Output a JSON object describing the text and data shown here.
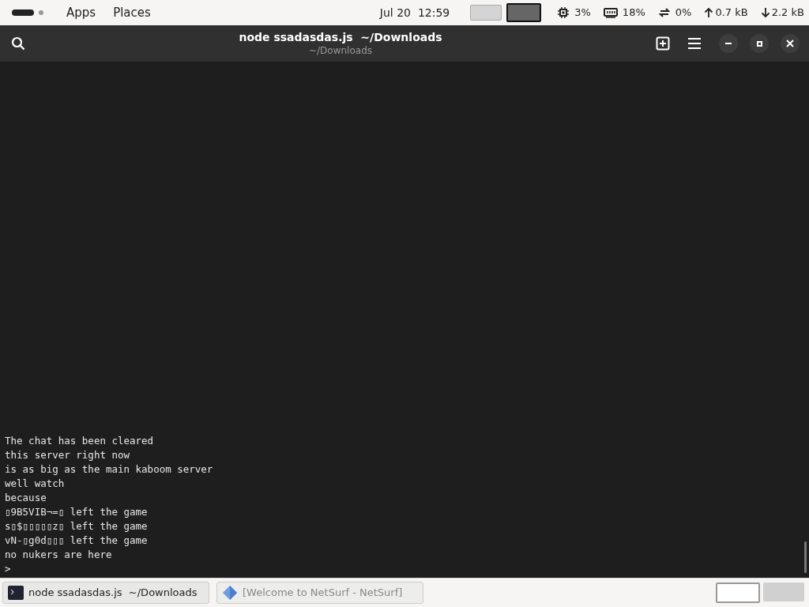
{
  "top_bar": {
    "menus": [
      "Apps",
      "Places"
    ],
    "clock": "Jul 20  12:59",
    "workspaces": [
      {
        "selected": false
      },
      {
        "selected": true
      }
    ],
    "indicators": [
      {
        "kind": "cpu",
        "text": "3%"
      },
      {
        "kind": "memory",
        "text": "18%"
      },
      {
        "kind": "swap",
        "text": "0%"
      },
      {
        "kind": "upload",
        "text": "0.7 kB"
      },
      {
        "kind": "download",
        "text": "2.2 kB"
      }
    ]
  },
  "window": {
    "title": "node ssadasdas.js  ~/Downloads",
    "subtitle": "~/Downloads"
  },
  "terminal": {
    "lines": [
      "The chat has been cleared",
      "this server right now",
      "is as big as the main kaboom server",
      "well watch",
      "because",
      "▯9B5VIB¬=▯ left the game",
      "s▯$▯▯▯▯▯z▯ left the game",
      "vN-▯g0d▯▯▯ left the game",
      "no nukers are here",
      ">"
    ]
  },
  "taskbar": {
    "tasks": [
      {
        "kind": "terminal",
        "label": "node ssadasdas.js  ~/Downloads",
        "selected": true
      },
      {
        "kind": "browser",
        "label": "[Welcome to NetSurf - NetSurf]",
        "selected": false
      }
    ],
    "workspaces": [
      {
        "selected": true
      },
      {
        "selected": false
      }
    ]
  }
}
